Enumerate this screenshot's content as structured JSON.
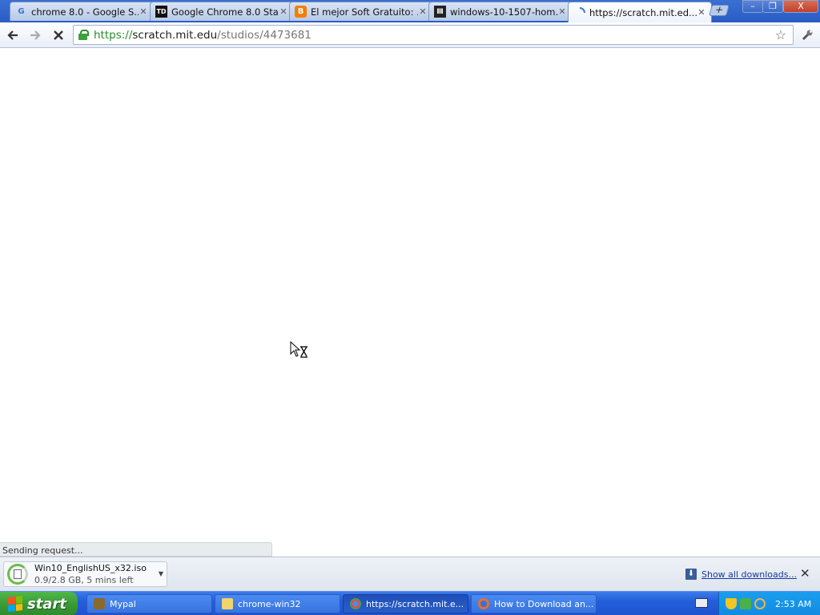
{
  "tabs": [
    {
      "title": "chrome 8.0 - Google S...",
      "favicon": "google-icon"
    },
    {
      "title": "Google Chrome 8.0 Sta...",
      "favicon": "td-icon"
    },
    {
      "title": "El mejor Soft Gratuito: ...",
      "favicon": "blogger-icon"
    },
    {
      "title": "windows-10-1507-hom...",
      "favicon": "archive-icon"
    },
    {
      "title": "https://scratch.mit.ed...",
      "favicon": "loading-spinner-icon"
    }
  ],
  "window_controls": {
    "minimize": "–",
    "restore": "❐",
    "close": "X"
  },
  "toolbar": {
    "url_scheme": "https://",
    "url_host": "scratch.mit.edu",
    "url_path": "/studios/4473681"
  },
  "status_text": "Sending request...",
  "download": {
    "filename": "Win10_EnglishUS_x32.iso",
    "progress_text": "0.9/2.8 GB, 5 mins left",
    "progress_fraction": 0.32
  },
  "show_all_downloads": "Show all downloads...",
  "taskbar": {
    "start_label": "start",
    "tasks": [
      {
        "label": "Mypal",
        "icon": "mypal-icon"
      },
      {
        "label": "chrome-win32",
        "icon": "folder-icon"
      },
      {
        "label": "https://scratch.mit.e...",
        "icon": "chrome-icon"
      },
      {
        "label": "How to Download an...",
        "icon": "firefox-icon"
      }
    ],
    "clock": "2:53 AM"
  },
  "colors": {
    "taskbar": "#245edb",
    "start": "#3a9c36",
    "url_scheme": "#2a8a2a"
  }
}
